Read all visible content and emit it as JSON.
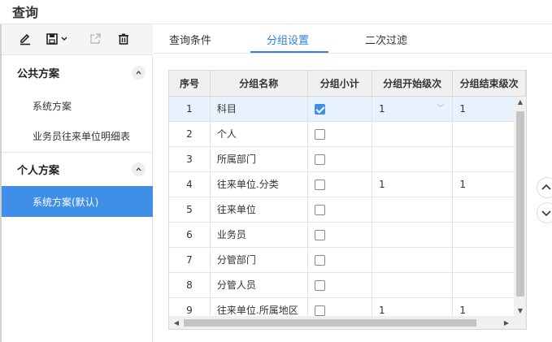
{
  "window": {
    "title": "查询"
  },
  "toolbar": {
    "icons": [
      "edit-icon",
      "save-icon",
      "export-icon",
      "delete-icon"
    ]
  },
  "sidebar": {
    "sections": [
      {
        "label": "公共方案",
        "items": [
          "系统方案",
          "业务员往来单位明细表"
        ]
      },
      {
        "label": "个人方案",
        "items": [
          "系统方案(默认)"
        ]
      }
    ],
    "active_item": "系统方案(默认)"
  },
  "tabs": [
    {
      "label": "查询条件",
      "active": false
    },
    {
      "label": "分组设置",
      "active": true
    },
    {
      "label": "二次过滤",
      "active": false
    }
  ],
  "grid": {
    "columns": [
      "序号",
      "分组名称",
      "分组小计",
      "分组开始级次",
      "分组结束级次"
    ],
    "rows": [
      {
        "no": "1",
        "name": "科目",
        "subtotal": true,
        "start": "1",
        "end": "1"
      },
      {
        "no": "2",
        "name": "个人",
        "subtotal": false,
        "start": "",
        "end": ""
      },
      {
        "no": "3",
        "name": "所属部门",
        "subtotal": false,
        "start": "",
        "end": ""
      },
      {
        "no": "4",
        "name": "往来单位.分类",
        "subtotal": false,
        "start": "1",
        "end": "1"
      },
      {
        "no": "5",
        "name": "往来单位",
        "subtotal": false,
        "start": "",
        "end": ""
      },
      {
        "no": "6",
        "name": "业务员",
        "subtotal": false,
        "start": "",
        "end": ""
      },
      {
        "no": "7",
        "name": "分管部门",
        "subtotal": false,
        "start": "",
        "end": ""
      },
      {
        "no": "8",
        "name": "分管人员",
        "subtotal": false,
        "start": "",
        "end": ""
      },
      {
        "no": "9",
        "name": "往来单位.所属地区",
        "subtotal": false,
        "start": "1",
        "end": "1"
      }
    ]
  },
  "accent_color": "#3f8ee8"
}
